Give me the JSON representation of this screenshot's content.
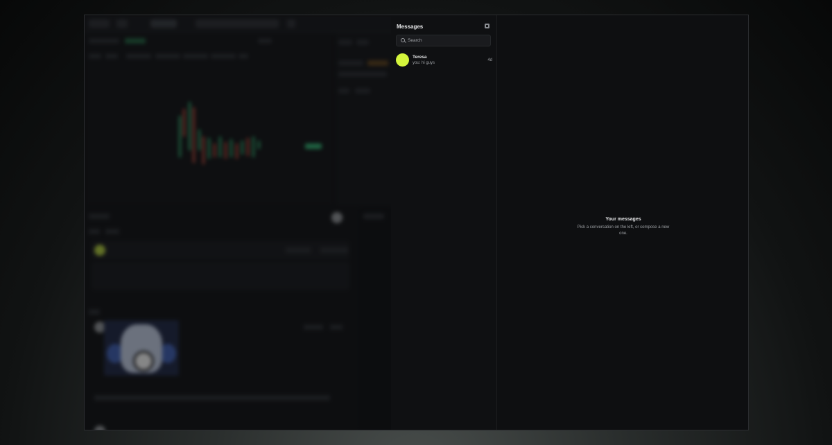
{
  "messages": {
    "title": "Messages",
    "search_placeholder": "Search",
    "conversations": [
      {
        "name": "Teresa",
        "preview": "you: hi guys",
        "time": "4d",
        "avatar_color": "#d4f53c"
      }
    ]
  },
  "empty_state": {
    "title": "Your messages",
    "subtitle": "Pick a conversation on the left, or compose a new one."
  },
  "colors": {
    "accent_avatar": "#d4f53c",
    "panel_bg": "#0f1012",
    "text_primary": "#e6e7e9",
    "text_secondary": "#9c9fa3"
  }
}
